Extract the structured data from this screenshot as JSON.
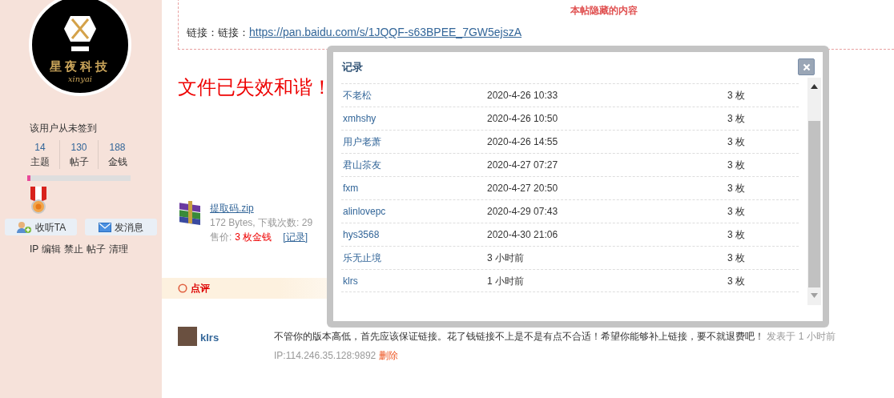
{
  "sidebar": {
    "avatar": {
      "title": "星夜科技",
      "subtitle": "xinyai"
    },
    "sign_status": "该用户从未签到",
    "stats": [
      {
        "value": "14",
        "label": "主题"
      },
      {
        "value": "130",
        "label": "帖子"
      },
      {
        "value": "188",
        "label": "金钱"
      }
    ],
    "progress": {
      "level": 0.03
    },
    "buttons": [
      {
        "kind": "follow",
        "label": "收听TA"
      },
      {
        "kind": "message",
        "label": "发消息"
      }
    ],
    "admin_links": [
      "IP",
      "编辑",
      "禁止",
      "帖子",
      "清理"
    ]
  },
  "hidden_content": {
    "title": "本帖隐藏的内容",
    "label": "链接：链接：",
    "url": "https://pan.baidu.com/s/1JQQF-s63BPEE_7GW5ejszA"
  },
  "notice": "文件已失效和谐！",
  "attachment": {
    "name": "提取码.zip",
    "info": "172 Bytes, 下载次数: 29",
    "price_label": "售价:",
    "price": "3 枚金钱",
    "record_link": "[记录]"
  },
  "review_bar": {
    "label": "点评"
  },
  "comment": {
    "author": "klrs",
    "text": "不管你的版本高低，首先应该保证链接。花了钱链接不上是不是有点不合适！希望你能够补上链接，要不就退费吧！",
    "time": "发表于 1 小时前",
    "ip": "IP:114.246.35.128:9892",
    "delete": "删除"
  },
  "dialog": {
    "title": "记录",
    "rows": [
      {
        "user": "不老松",
        "time": "2020-4-26 10:33",
        "amount": "3 枚"
      },
      {
        "user": "xmhshy",
        "time": "2020-4-26 10:50",
        "amount": "3 枚"
      },
      {
        "user": "用户老萧",
        "time": "2020-4-26 14:55",
        "amount": "3 枚"
      },
      {
        "user": "君山茶友",
        "time": "2020-4-27 07:27",
        "amount": "3 枚"
      },
      {
        "user": "fxm",
        "time": "2020-4-27 20:50",
        "amount": "3 枚"
      },
      {
        "user": "alinlovepc",
        "time": "2020-4-29 07:43",
        "amount": "3 枚"
      },
      {
        "user": "hys3568",
        "time": "2020-4-30 21:06",
        "amount": "3 枚"
      },
      {
        "user": "乐无止境",
        "time": "3 小时前",
        "amount": "3 枚"
      },
      {
        "user": "klrs",
        "time": "1 小时前",
        "amount": "3 枚"
      }
    ]
  }
}
